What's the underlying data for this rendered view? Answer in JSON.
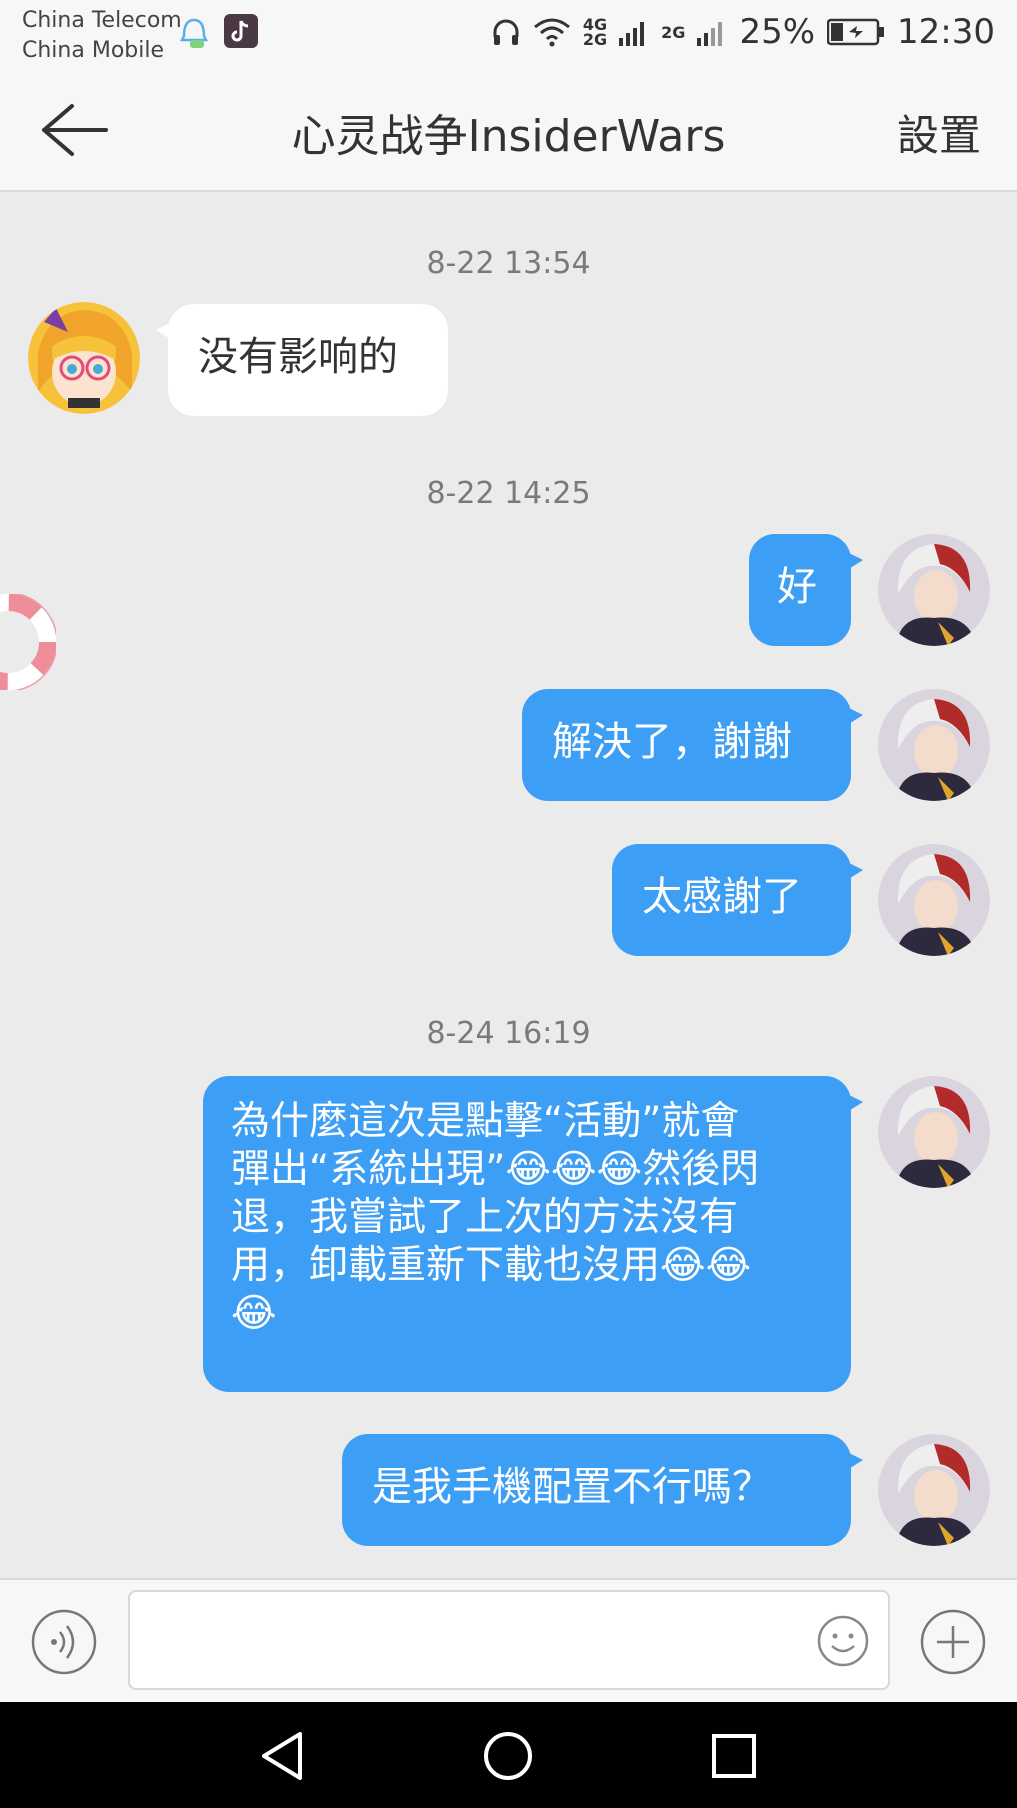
{
  "status_bar": {
    "carrier1": "China Telecom",
    "carrier2": "China Mobile",
    "net_label_top": "4G",
    "net_label_bottom": "2G",
    "net_label_2": "2G",
    "battery": "25%",
    "time": "12:30"
  },
  "header": {
    "title": "心灵战争InsiderWars",
    "settings_label": "設置"
  },
  "messages": [
    {
      "time": "8-22 13:54"
    },
    {
      "side": "left",
      "text": "没有影响的"
    },
    {
      "time": "8-22 14:25"
    },
    {
      "side": "right",
      "text": "好"
    },
    {
      "side": "right",
      "text": "解決了，謝謝"
    },
    {
      "side": "right",
      "text": "太感謝了"
    },
    {
      "time": "8-24 16:19"
    },
    {
      "side": "right",
      "text_line1": "為什麼這次是點擊“活動”就會",
      "text_line2a": "彈出“系統出現”",
      "text_line2b": "然後閃",
      "text_line3": "退，我嘗試了上次的方法沒有",
      "text_line4": "用，卸載重新下載也沒用"
    },
    {
      "side": "right",
      "text": "是我手機配置不行嗎？"
    }
  ],
  "input": {
    "placeholder": ""
  },
  "colors": {
    "bubble_right": "#3d9ef5",
    "bubble_left": "#ffffff",
    "background": "#ebebeb"
  },
  "icons": [
    "back-arrow-icon",
    "voice-icon",
    "emoji-icon",
    "plus-icon",
    "nav-back-icon",
    "nav-home-icon",
    "nav-recents-icon"
  ]
}
